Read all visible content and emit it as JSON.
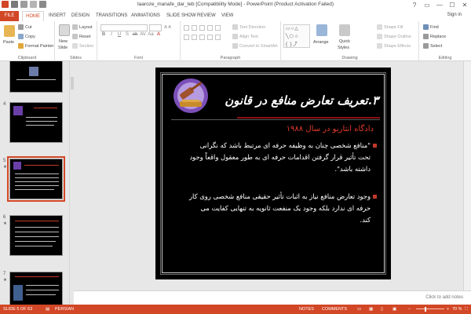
{
  "window": {
    "title": "taaroze_manafe_dar_teb [Compatibility Mode] - PowerPoint (Product Activation Failed)",
    "controls": [
      "?",
      "▭",
      "—",
      "☐",
      "✕"
    ]
  },
  "ribbon_tabs": [
    "FILE",
    "HOME",
    "INSERT",
    "DESIGN",
    "TRANSITIONS",
    "ANIMATIONS",
    "SLIDE SHOW",
    "REVIEW",
    "VIEW"
  ],
  "active_tab": "HOME",
  "sign_in": "Sign in",
  "ribbon": {
    "clipboard": {
      "label": "Clipboard",
      "paste": "Paste",
      "cut": "Cut",
      "copy": "Copy",
      "format_painter": "Format Painter"
    },
    "slides": {
      "label": "Slides",
      "new_slide_line1": "New",
      "new_slide_line2": "Slide",
      "layout": "Layout",
      "reset": "Reset",
      "section": "Section"
    },
    "font": {
      "label": "Font"
    },
    "paragraph": {
      "label": "Paragraph",
      "text_direction": "Text Direction",
      "align_text": "Align Text",
      "convert_smartart": "Convert to SmartArt"
    },
    "drawing": {
      "label": "Drawing",
      "arrange": "Arrange",
      "quick_styles_line1": "Quick",
      "quick_styles_line2": "Styles",
      "shape_fill": "Shape Fill",
      "shape_outline": "Shape Outline",
      "shape_effects": "Shape Effects"
    },
    "editing": {
      "label": "Editing",
      "find": "Find",
      "replace": "Replace",
      "select": "Select"
    }
  },
  "thumbnails": [
    {
      "number": "",
      "star": ""
    },
    {
      "number": "4",
      "star": ""
    },
    {
      "number": "5",
      "star": "★"
    },
    {
      "number": "6",
      "star": "★"
    },
    {
      "number": "7",
      "star": "★"
    }
  ],
  "slide": {
    "title": "۳.تعریف تعارض منافع در قانون",
    "subtitle": "دادگاه انتاریو در سال ۱۹۸۸",
    "para1": "\"منافع شخصی چنان به وظیفه حرفه ای مرتبط باشد که نگرانی تحت تأثیر قرار گرفتن اقدامات حرفه ای به طور معقول واقعاً وجود داشته باشد\".",
    "para2": "وجود تعارض منافع نیاز به اثبات تأثیر حقیقی منافع شخصی روی کار حرفه ای ندارد بلکه وجود یک منفعت ثانویه به تنهایی کفایت می کند."
  },
  "notes_placeholder": "Click to add notes",
  "status": {
    "slide_info": "SLIDE 5 OF 63",
    "language": "PERSIAN",
    "notes": "NOTES",
    "comments": "COMMENTS",
    "zoom": "70 %",
    "zoom_level_percent": 70
  },
  "colors": {
    "accent": "#d24726",
    "slide_bg": "#000000",
    "subtitle": "#e03a2a"
  }
}
